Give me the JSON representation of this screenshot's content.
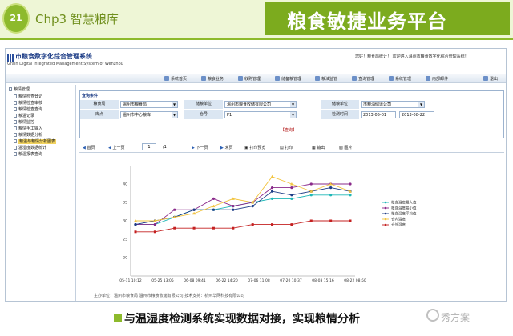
{
  "slide": {
    "chapter_number": "21",
    "chapter_title": "Chp3  智慧粮库",
    "platform_title": "粮食敏捷业务平台",
    "caption": "与温湿度检测系统实现数据对接，实现粮情分析",
    "watermark": "秀方案",
    "accent_color": "#8dba2c",
    "brand_band_color": "#7cab1e"
  },
  "app": {
    "title": "市粮食数字化综合管理系统",
    "subtitle": "Grain Digital Integrated Management System of Wenzhou",
    "welcome": "您好！粮食局统计！ 欢迎进入温州市粮食数字化综合管理系统！",
    "nav": [
      "系统首页",
      "粮食业务",
      "收购管理",
      "储备粮管理",
      "粮油监管",
      "查询管理",
      "系统管理",
      "内部邮件",
      "退出"
    ],
    "tree": {
      "root": "粮情管理",
      "items": [
        "粮情检查登记",
        "粮情检查审核",
        "粮情检查查询",
        "粮温记录",
        "粮情监控",
        "粮情手工输入",
        "粮情数据分析",
        "粮温与粮情分析图表",
        "温湿度数据统计",
        "粮温报表查询"
      ],
      "selected_index": 7
    },
    "query": {
      "caption": "查询条件",
      "labels": [
        "粮食局",
        "库点",
        "储粮单位",
        "仓号",
        "储粮单位",
        "检测时间"
      ],
      "values": [
        "温州市粮食局",
        "温州市中心粮库",
        "温州市粮食收储有限公司",
        "P1",
        "市粮油储运公司",
        "2013-05-01",
        "2013-08-22"
      ],
      "button": "【查询】"
    },
    "pager": {
      "first": "首页",
      "prev": "上一页",
      "page": "1",
      "total": "/1",
      "next": "下一页",
      "last": "末页",
      "print_preview": "打印预览",
      "print": "打印",
      "export": "输出",
      "chart": "图片"
    },
    "footer": "主办单位：温州市粮食局  温州市粮食收储有限公司    技术支持：杭州华网科技有限公司"
  },
  "chart_data": {
    "type": "line",
    "x": [
      "05-11 10:12",
      "05-25 13:05",
      "06-08 09:41",
      "06-22 14:20",
      "07-06 11:08",
      "07-20 10:37",
      "08-03 15:16",
      "08-22 08:50"
    ],
    "ylim": [
      15,
      45
    ],
    "yticks": [
      20,
      25,
      30,
      35,
      40
    ],
    "series": [
      {
        "name": "粮食温度最大值",
        "color": "#1fb7b7",
        "marker": "circle",
        "values": [
          29,
          29,
          31,
          33,
          33,
          34,
          35,
          36,
          36,
          37,
          37,
          37
        ]
      },
      {
        "name": "粮食温度最小值",
        "color": "#8a2a8a",
        "marker": "circle",
        "values": [
          29,
          29,
          33,
          33,
          36,
          34,
          35,
          39,
          39,
          40,
          40,
          40
        ]
      },
      {
        "name": "粮食温度平均值",
        "color": "#1c3c86",
        "marker": "circle",
        "values": [
          29,
          30,
          31,
          33,
          33,
          33,
          34,
          38,
          37,
          38,
          39,
          38
        ]
      },
      {
        "name": "仓内温度",
        "color": "#f2c440",
        "marker": "triangle",
        "values": [
          30,
          30,
          31,
          32,
          34,
          36,
          35,
          42,
          40,
          38,
          40,
          38
        ]
      },
      {
        "name": "仓外湿度",
        "color": "#c42020",
        "marker": "square",
        "values": [
          27,
          27,
          28,
          28,
          28,
          28,
          29,
          29,
          29,
          30,
          30,
          30
        ]
      }
    ]
  }
}
